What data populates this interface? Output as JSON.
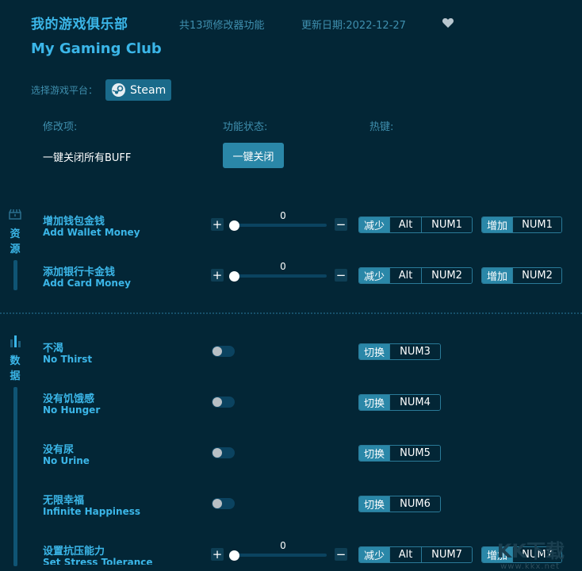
{
  "header": {
    "title_cn": "我的游戏俱乐部",
    "title_en": "My Gaming Club",
    "feature_count": "共13项修改器功能",
    "update_date": "更新日期:2022-12-27",
    "favorite_icon": "heart-icon"
  },
  "platform": {
    "label": "选择游戏平台：",
    "selected": "Steam",
    "icon": "steam-icon"
  },
  "columns": {
    "item": "修改项:",
    "status": "功能状态:",
    "hotkey": "热键:"
  },
  "all_buff": {
    "label": "一键关闭所有BUFF",
    "button": "一键关闭"
  },
  "categories": [
    {
      "label_1": "资",
      "label_2": "源",
      "icon": "treasure-chest-icon"
    },
    {
      "label_1": "数",
      "label_2": "据",
      "icon": "bar-chart-icon"
    }
  ],
  "items": [
    {
      "cn": "增加钱包金钱",
      "en": "Add Wallet Money",
      "type": "slider",
      "value": "0",
      "decrease": {
        "tag": "减少",
        "mod": "Alt",
        "key": "NUM1"
      },
      "increase": {
        "tag": "增加",
        "key": "NUM1"
      }
    },
    {
      "cn": "添加银行卡金钱",
      "en": "Add Card Money",
      "type": "slider",
      "value": "0",
      "decrease": {
        "tag": "减少",
        "mod": "Alt",
        "key": "NUM2"
      },
      "increase": {
        "tag": "增加",
        "key": "NUM2"
      }
    },
    {
      "cn": "不渴",
      "en": "No Thirst",
      "type": "toggle",
      "on": false,
      "toggle": {
        "tag": "切换",
        "key": "NUM3"
      }
    },
    {
      "cn": "没有饥饿感",
      "en": "No Hunger",
      "type": "toggle",
      "on": false,
      "toggle": {
        "tag": "切换",
        "key": "NUM4"
      }
    },
    {
      "cn": "没有尿",
      "en": "No Urine",
      "type": "toggle",
      "on": false,
      "toggle": {
        "tag": "切换",
        "key": "NUM5"
      }
    },
    {
      "cn": "无限幸福",
      "en": "Infinite Happiness",
      "type": "toggle",
      "on": false,
      "toggle": {
        "tag": "切换",
        "key": "NUM6"
      }
    },
    {
      "cn": "设置抗压能力",
      "en": "Set Stress Tolerance",
      "type": "slider",
      "value": "0",
      "decrease": {
        "tag": "减少",
        "mod": "Alt",
        "key": "NUM7"
      },
      "increase": {
        "tag": "增加",
        "key": "NUM7"
      }
    }
  ],
  "watermark": {
    "logo": "KK下载",
    "url": "www.kkx.net"
  }
}
